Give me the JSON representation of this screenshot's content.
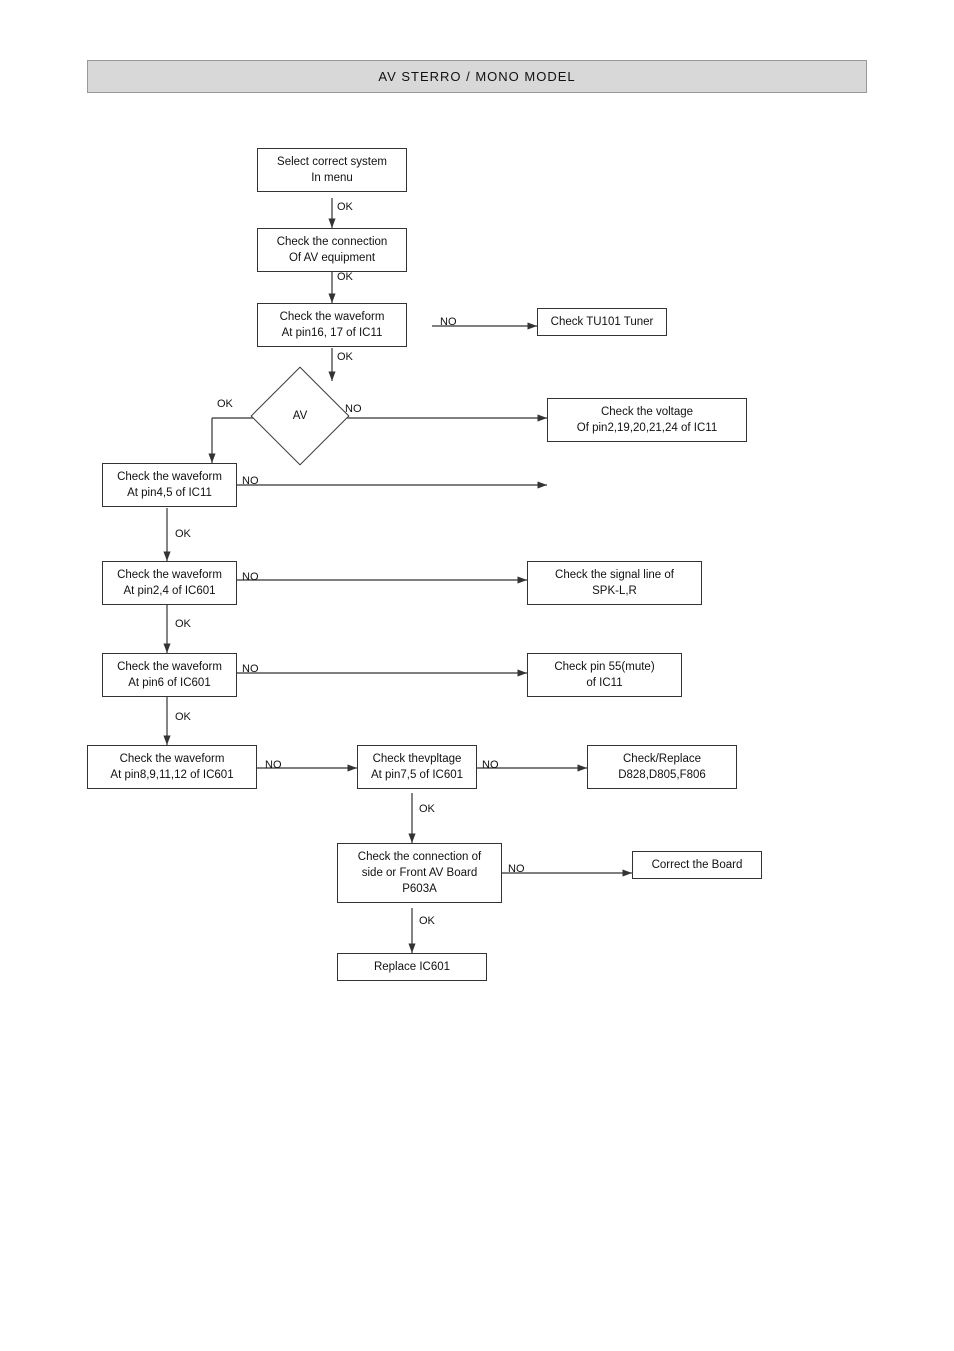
{
  "title": "AV STERRO / MONO  MODEL",
  "boxes": {
    "select": {
      "text": "Select correct system\nIn menu"
    },
    "check_conn_av": {
      "text": "Check the connection\nOf AV equipment"
    },
    "check_wf_16_17": {
      "text": "Check the waveform\nAt pin16, 17 of IC11"
    },
    "check_tu101": {
      "text": "Check TU101 Tuner"
    },
    "check_wf_4_5": {
      "text": "Check the waveform\nAt pin4,5 of IC11"
    },
    "check_voltage_pin2": {
      "text": "Check the voltage\nOf pin2,19,20,21,24 of IC11"
    },
    "check_wf_2_4": {
      "text": "Check the waveform\nAt pin2,4 of IC601"
    },
    "check_spk": {
      "text": "Check the signal line of\nSPK-L,R"
    },
    "check_wf_6": {
      "text": "Check the waveform\nAt pin6 of IC601"
    },
    "check_pin55": {
      "text": "Check pin 55(mute)\nof IC11"
    },
    "check_wf_8_9": {
      "text": "Check the waveform\nAt pin8,9,11,12 of IC601"
    },
    "check_voltage_7_5": {
      "text": "Check thevpltage\nAt pin7,5 of IC601"
    },
    "check_replace": {
      "text": "Check/Replace\nD828,D805,F806"
    },
    "check_conn_side": {
      "text": "Check the connection of\nside or Front AV Board\nP603A"
    },
    "correct_board": {
      "text": "Correct the Board"
    },
    "replace_ic601": {
      "text": "Replace IC601"
    }
  },
  "labels": {
    "ok": "OK",
    "no": "NO",
    "av": "AV"
  }
}
